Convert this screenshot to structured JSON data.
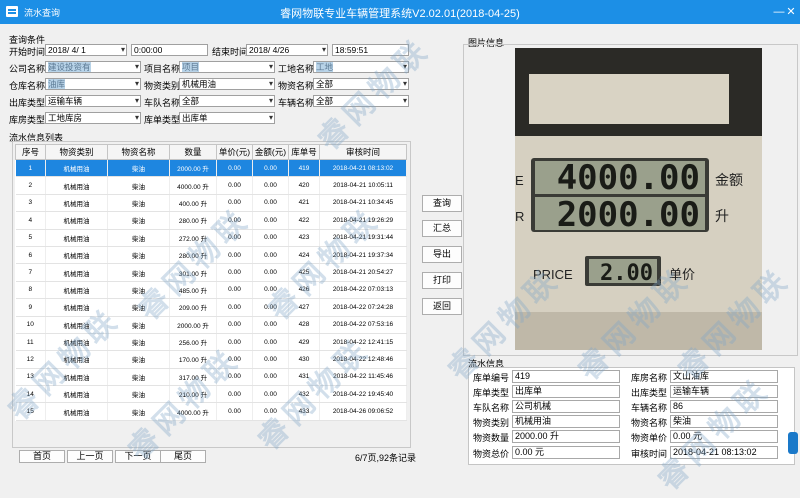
{
  "window": {
    "label": "流水查询",
    "title": "睿网物联专业车辆管理系统V2.02.01(2018-04-25)"
  },
  "query": {
    "title": "查询条件",
    "start_label": "开始时间",
    "start_date": "2018/ 4/ 1",
    "start_time": "0:00:00",
    "end_label": "结束时间",
    "end_date": "2018/ 4/26",
    "end_time": "18:59:51",
    "company_label": "公司名称",
    "company_value": "建设投资有",
    "project_label": "项目名称",
    "project_value": "项目",
    "site_label": "工地名称",
    "site_value": "工地",
    "warehouse_label": "仓库名称",
    "warehouse_value": "油库",
    "mat_type_label": "物资类别",
    "mat_type_value": "机械用油",
    "mat_name_label": "物资名称",
    "mat_name_value": "全部",
    "out_type_label": "出库类型",
    "out_type_value": "运输车辆",
    "team_label": "车队名称",
    "team_value": "全部",
    "vehicle_label": "车辆名称",
    "vehicle_value": "全部",
    "wh_type_label": "库房类型",
    "wh_type_value": "工地库房",
    "doc_type_label": "库单类型",
    "doc_type_value": "出库单"
  },
  "list": {
    "title": "流水信息列表",
    "headers": [
      "序号",
      "物资类别",
      "物资名称",
      "数量",
      "单价(元)",
      "金额(元)",
      "库单号",
      "审核时间"
    ],
    "rows": [
      [
        "1",
        "机械用油",
        "柴油",
        "2000.00 升",
        "0.00",
        "0.00",
        "419",
        "2018-04-21 08:13:02"
      ],
      [
        "2",
        "机械用油",
        "柴油",
        "4000.00 升",
        "0.00",
        "0.00",
        "420",
        "2018-04-21 10:05:11"
      ],
      [
        "3",
        "机械用油",
        "柴油",
        "400.00 升",
        "0.00",
        "0.00",
        "421",
        "2018-04-21 10:34:45"
      ],
      [
        "4",
        "机械用油",
        "柴油",
        "280.00 升",
        "0.00",
        "0.00",
        "422",
        "2018-04-21 19:26:29"
      ],
      [
        "5",
        "机械用油",
        "柴油",
        "272.00 升",
        "0.00",
        "0.00",
        "423",
        "2018-04-21 19:31:44"
      ],
      [
        "6",
        "机械用油",
        "柴油",
        "280.00 升",
        "0.00",
        "0.00",
        "424",
        "2018-04-21 19:37:34"
      ],
      [
        "7",
        "机械用油",
        "柴油",
        "301.00 升",
        "0.00",
        "0.00",
        "425",
        "2018-04-21 20:54:27"
      ],
      [
        "8",
        "机械用油",
        "柴油",
        "485.00 升",
        "0.00",
        "0.00",
        "426",
        "2018-04-22 07:03:13"
      ],
      [
        "9",
        "机械用油",
        "柴油",
        "209.00 升",
        "0.00",
        "0.00",
        "427",
        "2018-04-22 07:24:28"
      ],
      [
        "10",
        "机械用油",
        "柴油",
        "2000.00 升",
        "0.00",
        "0.00",
        "428",
        "2018-04-22 07:53:16"
      ],
      [
        "11",
        "机械用油",
        "柴油",
        "256.00 升",
        "0.00",
        "0.00",
        "429",
        "2018-04-22 12:41:15"
      ],
      [
        "12",
        "机械用油",
        "柴油",
        "170.00 升",
        "0.00",
        "0.00",
        "430",
        "2018-04-22 12:48:46"
      ],
      [
        "13",
        "机械用油",
        "柴油",
        "317.00 升",
        "0.00",
        "0.00",
        "431",
        "2018-04-22 11:45:46"
      ],
      [
        "14",
        "机械用油",
        "柴油",
        "210.00 升",
        "0.00",
        "0.00",
        "432",
        "2018-04-22 19:45:40"
      ],
      [
        "15",
        "机械用油",
        "柴油",
        "4000.00 升",
        "0.00",
        "0.00",
        "433",
        "2018-04-26 09:06:52"
      ]
    ]
  },
  "buttons": {
    "query": "查询",
    "summary": "汇总",
    "export": "导出",
    "print": "打印",
    "back": "返回"
  },
  "pager": {
    "first": "首页",
    "prev": "上一页",
    "next": "下一页",
    "last": "尾页",
    "status": "6/7页,92条记录"
  },
  "photo": {
    "title": "图片信息",
    "display1": "4000.00",
    "display2": "2000.00",
    "display3": "2.00",
    "sign_amount": "金额",
    "sign_liter": "升",
    "sign_price": "PRICE",
    "sign_unit": "单价",
    "sign_e": "E",
    "sign_r": "R"
  },
  "info": {
    "title": "流水信息",
    "doc_no_label": "库单编号",
    "doc_no": "419",
    "wh_name_label": "库房名称",
    "wh_name": "文山油库",
    "doc_type_label": "库单类型",
    "doc_type": "出库单",
    "out_type_label": "出库类型",
    "out_type": "运输车辆",
    "team_label": "车队名称",
    "team": "公司机械",
    "vehicle_label": "车辆名称",
    "vehicle": "86",
    "mat_type_label": "物资类别",
    "mat_type": "机械用油",
    "mat_name_label": "物资名称",
    "mat_name": "柴油",
    "qty_label": "物资数量",
    "qty": "2000.00 升",
    "price_label": "物资单价",
    "price": "0.00 元",
    "total_label": "物资总价",
    "total": "0.00 元",
    "audit_label": "审核时间",
    "audit": "2018-04-21 08:13:02"
  },
  "watermark": "睿网物联",
  "colors": {
    "titlebar": "#1c8fe6",
    "selected_row": "#1e86e0"
  }
}
